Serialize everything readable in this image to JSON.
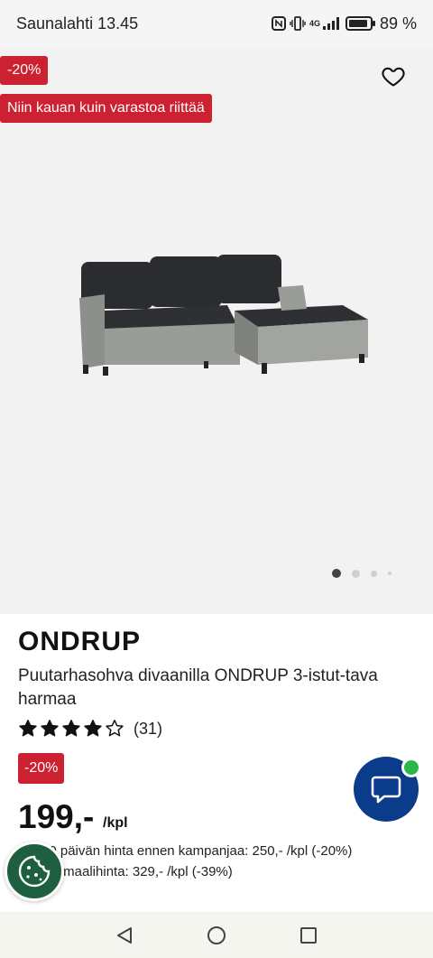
{
  "status_bar": {
    "carrier_time": "Saunalahti 13.45",
    "network": "4G",
    "battery_level": 0.89,
    "battery_text": "89 %"
  },
  "hero": {
    "discount_badge": "-20%",
    "stock_badge": "Niin kauan kuin varastoa riittää",
    "favorite_icon": "heart-outline-icon",
    "carousel": {
      "total": 4,
      "active": 1
    }
  },
  "product": {
    "brand": "ONDRUP",
    "description": "Puutarhasohva divaanilla ONDRUP 3-istut-tava harmaa",
    "rating": {
      "value": 4.0,
      "max": 5,
      "count": "(31)"
    },
    "price_badge": "-20%",
    "price": "199,-",
    "unit": "/kpl",
    "previous_price_text": "30 päivän hinta ennen kampanjaa: 250,- /kpl (-20%)",
    "normal_price_text": "Normaalihinta: 329,- /kpl (-39%)"
  },
  "floating": {
    "chat_icon": "chat-bubble-icon",
    "cookie_icon": "cookie-icon"
  },
  "colors": {
    "sale_red": "#cc2130",
    "chat_blue": "#0b3c8c",
    "online_green": "#2bb64a",
    "cookie_green": "#1d5f3e"
  },
  "nav_bar": {
    "back_icon": "back-triangle-icon",
    "home_icon": "home-circle-icon",
    "recents_icon": "recents-square-icon"
  }
}
